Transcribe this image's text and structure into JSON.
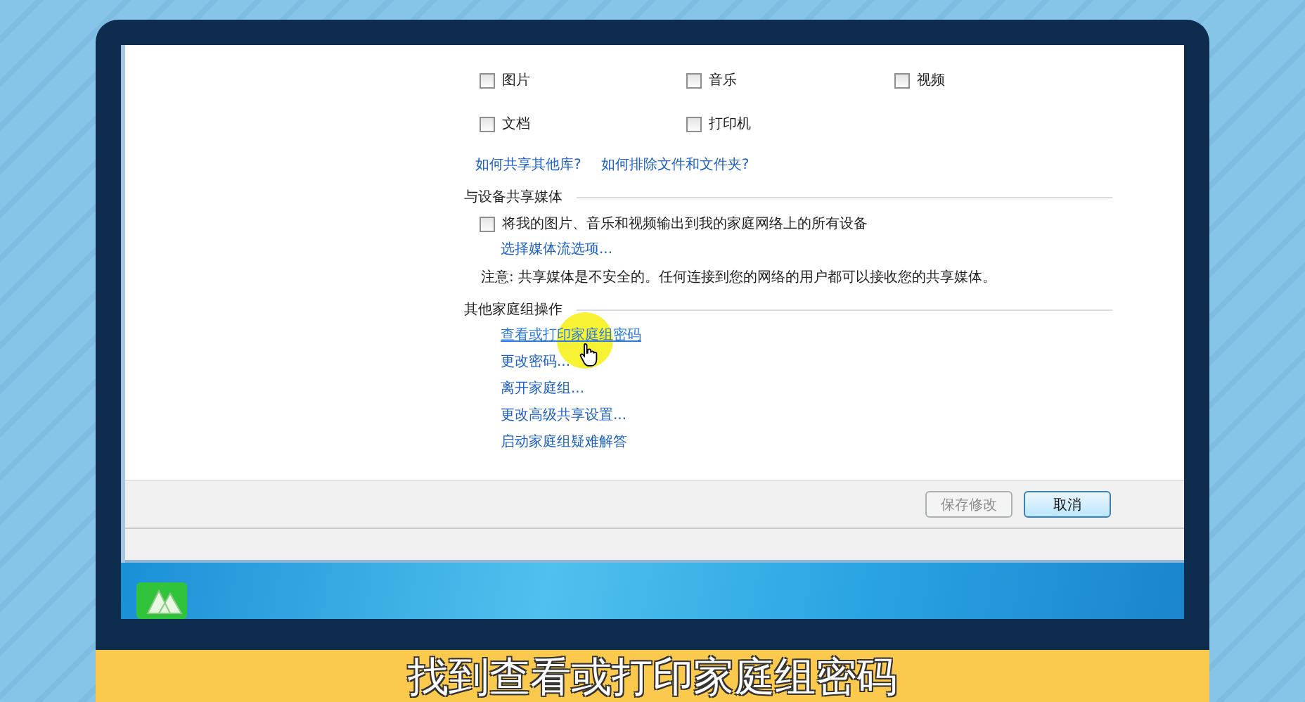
{
  "sharing_options": [
    {
      "label": "图片",
      "checked": false
    },
    {
      "label": "音乐",
      "checked": false
    },
    {
      "label": "视频",
      "checked": false
    },
    {
      "label": "文档",
      "checked": false
    },
    {
      "label": "打印机",
      "checked": false
    }
  ],
  "library_links": [
    {
      "label": "如何共享其他库?"
    },
    {
      "label": "如何排除文件和文件夹?"
    }
  ],
  "media_section": {
    "heading": "与设备共享媒体",
    "stream_option": {
      "label": "将我的图片、音乐和视频输出到我的家庭网络上的所有设备",
      "checked": false
    },
    "link": "选择媒体流选项...",
    "note": "注意: 共享媒体是不安全的。任何连接到您的网络的用户都可以接收您的共享媒体。"
  },
  "other_section": {
    "heading": "其他家庭组操作",
    "links": [
      {
        "label": "查看或打印家庭组密码",
        "hovered": true
      },
      {
        "label": "更改密码...",
        "hovered": false
      },
      {
        "label": "离开家庭组...",
        "hovered": false
      },
      {
        "label": "更改高级共享设置...",
        "hovered": false
      },
      {
        "label": "启动家庭组疑难解答",
        "hovered": false
      }
    ]
  },
  "buttons": [
    {
      "label": "保存修改",
      "disabled": true,
      "default": false
    },
    {
      "label": "取消",
      "disabled": false,
      "default": true
    }
  ],
  "subtitle": "找到查看或打印家庭组密码"
}
